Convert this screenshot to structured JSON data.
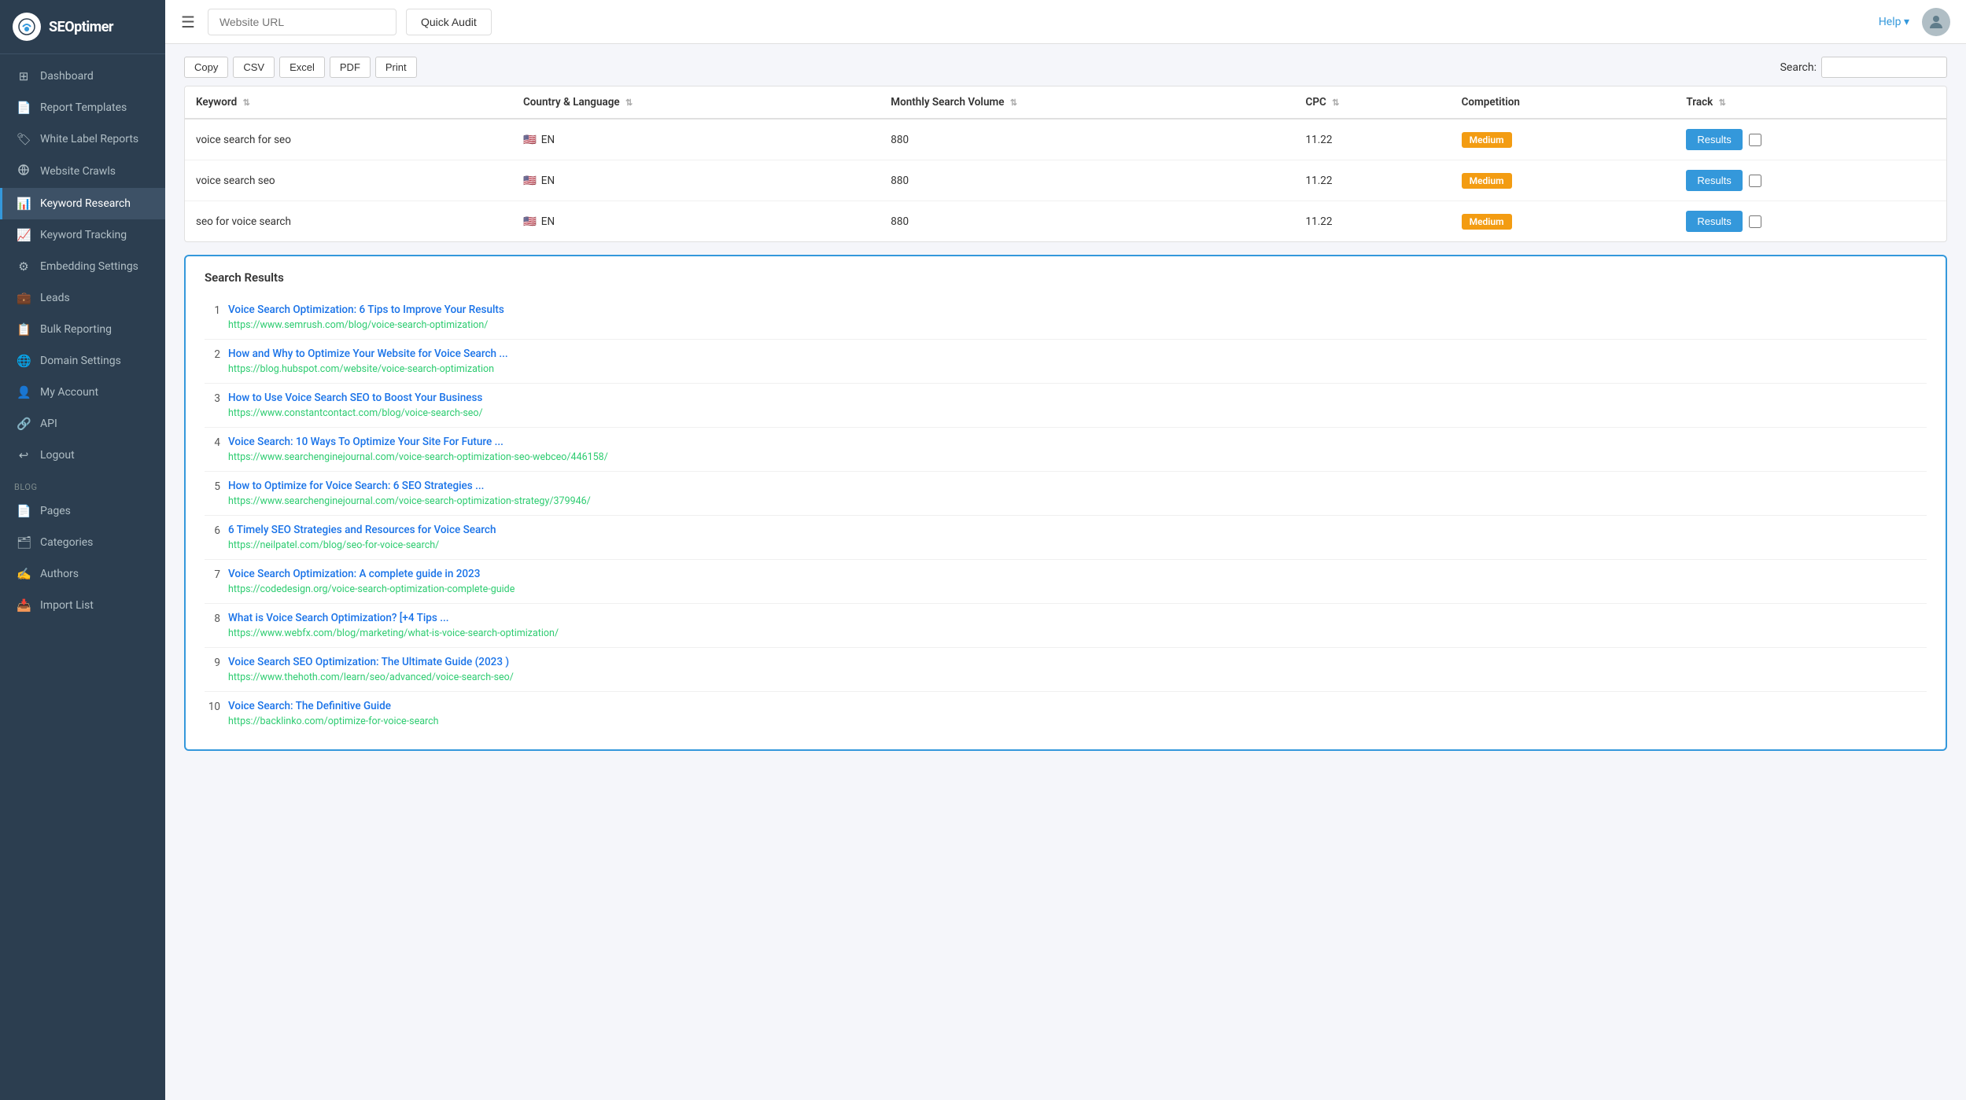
{
  "brand": {
    "logo_text": "SEOptimer",
    "logo_icon": "S"
  },
  "header": {
    "url_placeholder": "Website URL",
    "quick_audit_label": "Quick Audit",
    "help_label": "Help ▾"
  },
  "sidebar": {
    "items": [
      {
        "id": "dashboard",
        "label": "Dashboard",
        "icon": "⊞",
        "active": false
      },
      {
        "id": "report-templates",
        "label": "Report Templates",
        "icon": "📄",
        "active": false
      },
      {
        "id": "white-label-reports",
        "label": "White Label Reports",
        "icon": "🏷",
        "active": false
      },
      {
        "id": "website-crawls",
        "label": "Website Crawls",
        "icon": "🔍",
        "active": false
      },
      {
        "id": "keyword-research",
        "label": "Keyword Research",
        "icon": "📊",
        "active": true
      },
      {
        "id": "keyword-tracking",
        "label": "Keyword Tracking",
        "icon": "📈",
        "active": false
      },
      {
        "id": "embedding-settings",
        "label": "Embedding Settings",
        "icon": "⚙",
        "active": false
      },
      {
        "id": "leads",
        "label": "Leads",
        "icon": "💼",
        "active": false
      },
      {
        "id": "bulk-reporting",
        "label": "Bulk Reporting",
        "icon": "📋",
        "active": false
      },
      {
        "id": "domain-settings",
        "label": "Domain Settings",
        "icon": "🌐",
        "active": false
      },
      {
        "id": "my-account",
        "label": "My Account",
        "icon": "👤",
        "active": false
      },
      {
        "id": "api",
        "label": "API",
        "icon": "🔗",
        "active": false
      },
      {
        "id": "logout",
        "label": "Logout",
        "icon": "↩",
        "active": false
      }
    ],
    "blog_section_label": "Blog",
    "blog_items": [
      {
        "id": "pages",
        "label": "Pages",
        "icon": "📄"
      },
      {
        "id": "categories",
        "label": "Categories",
        "icon": "🗂"
      },
      {
        "id": "authors",
        "label": "Authors",
        "icon": "✍"
      },
      {
        "id": "import-list",
        "label": "Import List",
        "icon": "📥"
      }
    ]
  },
  "table_controls": {
    "copy_label": "Copy",
    "csv_label": "CSV",
    "excel_label": "Excel",
    "pdf_label": "PDF",
    "print_label": "Print",
    "search_label": "Search:"
  },
  "table": {
    "columns": [
      {
        "id": "keyword",
        "label": "Keyword"
      },
      {
        "id": "country-language",
        "label": "Country & Language"
      },
      {
        "id": "monthly-search-volume",
        "label": "Monthly Search Volume"
      },
      {
        "id": "cpc",
        "label": "CPC"
      },
      {
        "id": "competition",
        "label": "Competition"
      },
      {
        "id": "track",
        "label": "Track"
      }
    ],
    "rows": [
      {
        "keyword": "voice search for seo",
        "flag": "🇺🇸",
        "language": "EN",
        "monthly_search_volume": "880",
        "cpc": "11.22",
        "competition": "Medium",
        "competition_class": "medium"
      },
      {
        "keyword": "voice search seo",
        "flag": "🇺🇸",
        "language": "EN",
        "monthly_search_volume": "880",
        "cpc": "11.22",
        "competition": "Medium",
        "competition_class": "medium"
      },
      {
        "keyword": "seo for voice search",
        "flag": "🇺🇸",
        "language": "EN",
        "monthly_search_volume": "880",
        "cpc": "11.22",
        "competition": "Medium",
        "competition_class": "medium"
      }
    ],
    "results_btn_label": "Results"
  },
  "search_results": {
    "title": "Search Results",
    "items": [
      {
        "num": 1,
        "title": "Voice Search Optimization: 6 Tips to Improve Your Results",
        "url": "https://www.semrush.com/blog/voice-search-optimization/"
      },
      {
        "num": 2,
        "title": "How and Why to Optimize Your Website for Voice Search ...",
        "url": "https://blog.hubspot.com/website/voice-search-optimization"
      },
      {
        "num": 3,
        "title": "How to Use Voice Search SEO to Boost Your Business",
        "url": "https://www.constantcontact.com/blog/voice-search-seo/"
      },
      {
        "num": 4,
        "title": "Voice Search: 10 Ways To Optimize Your Site For Future ...",
        "url": "https://www.searchenginejournal.com/voice-search-optimization-seo-webceo/446158/"
      },
      {
        "num": 5,
        "title": "How to Optimize for Voice Search: 6 SEO Strategies ...",
        "url": "https://www.searchenginejournal.com/voice-search-optimization-strategy/379946/"
      },
      {
        "num": 6,
        "title": "6 Timely SEO Strategies and Resources for Voice Search",
        "url": "https://neilpatel.com/blog/seo-for-voice-search/"
      },
      {
        "num": 7,
        "title": "Voice Search Optimization: A complete guide in 2023",
        "url": "https://codedesign.org/voice-search-optimization-complete-guide"
      },
      {
        "num": 8,
        "title": "What is Voice Search Optimization? [+4 Tips ...",
        "url": "https://www.webfx.com/blog/marketing/what-is-voice-search-optimization/"
      },
      {
        "num": 9,
        "title": "Voice Search SEO Optimization: The Ultimate Guide (2023 )",
        "url": "https://www.thehoth.com/learn/seo/advanced/voice-search-seo/"
      },
      {
        "num": 10,
        "title": "Voice Search: The Definitive Guide",
        "url": "https://backlinko.com/optimize-for-voice-search"
      }
    ]
  }
}
